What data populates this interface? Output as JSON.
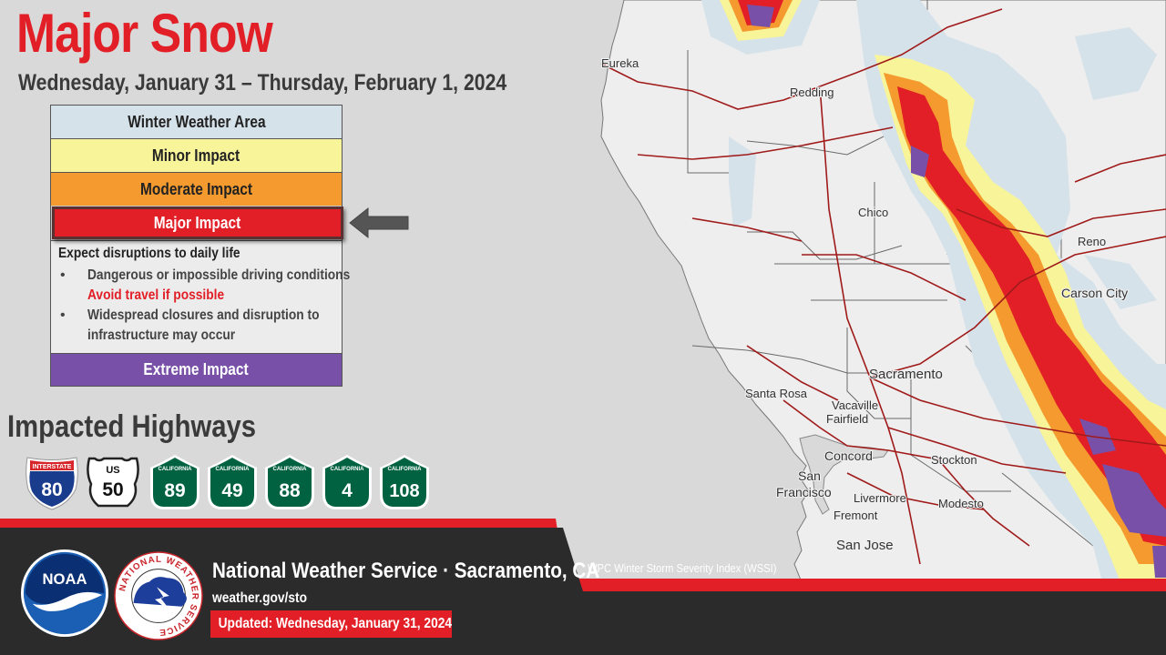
{
  "title": "Major Snow",
  "subtitle": "Wednesday, January 31 – Thursday, February 1, 2024",
  "legend": {
    "levels": [
      {
        "label": "Winter Weather Area",
        "color": "#d6e2ea"
      },
      {
        "label": "Minor Impact",
        "color": "#f8f49a"
      },
      {
        "label": "Moderate Impact",
        "color": "#f49a2e"
      },
      {
        "label": "Major Impact",
        "color": "#e21f26"
      },
      {
        "label": "Extreme Impact",
        "color": "#7850a8"
      }
    ],
    "selected": "Major Impact",
    "details_heading": "Expect disruptions to daily life",
    "bullet1": "Dangerous or impossible driving conditions",
    "bullet1_warning": "Avoid travel if possible",
    "bullet2_line1": "Widespread closures and disruption to",
    "bullet2_line2": "infrastructure may occur"
  },
  "highways_title": "Impacted Highways",
  "highways": [
    {
      "type": "INTERSTATE",
      "number": "80"
    },
    {
      "type": "US",
      "number": "50"
    },
    {
      "type": "CALIFORNIA",
      "number": "89"
    },
    {
      "type": "CALIFORNIA",
      "number": "49"
    },
    {
      "type": "CALIFORNIA",
      "number": "88"
    },
    {
      "type": "CALIFORNIA",
      "number": "4"
    },
    {
      "type": "CALIFORNIA",
      "number": "108"
    }
  ],
  "map": {
    "cities": [
      "Eureka",
      "Redding",
      "Chico",
      "Reno",
      "Carson City",
      "Sacramento",
      "Santa Rosa",
      "Vacaville",
      "Fairfield",
      "Concord",
      "Stockton",
      "San",
      "Francisco",
      "Livermore",
      "Modesto",
      "Fremont",
      "San Jose"
    ],
    "source": "WPC Winter Storm Severity Index (WSSI)"
  },
  "footer": {
    "office": "National Weather Service · Sacramento, CA",
    "website": "weather.gov/sto",
    "updated": "Updated: Wednesday, January 31, 2024",
    "noaa_logo_text": "NOAA",
    "nws_logo_text": "NATIONAL WEATHER SERVICE"
  },
  "colors": {
    "accent": "#e21f26",
    "footer_bg": "#2b2b2b",
    "ocean": "#d9d9d9",
    "land": "#eeeeee",
    "highway_road": "#a01a1a",
    "ca_shield": "#006241",
    "interstate_blue": "#1a3c8c"
  }
}
